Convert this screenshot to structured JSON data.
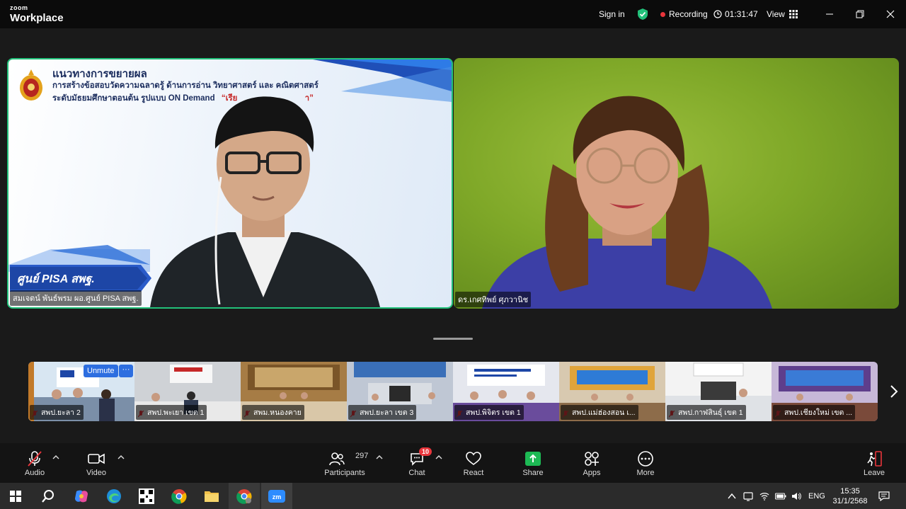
{
  "app": {
    "brand_top": "zoom",
    "brand_bottom": "Workplace",
    "sign_in": "Sign in",
    "recording_label": "Recording",
    "timer": "01:31:47",
    "view_label": "View"
  },
  "slide": {
    "title": "แนวทางการขยายผล",
    "line1": "การสร้างข้อสอบวัดความฉลาดรู้ ด้านการอ่าน วิทยาศาสตร์ และ คณิตศาสตร์",
    "line2": "ระดับมัธยมศึกษาตอนต้น รูปแบบ ON Demand",
    "line2_quote": "“เรีย",
    "line2_end": "า”",
    "banner": "ศูนย์ PISA สพฐ."
  },
  "participants_main": [
    {
      "name": "สมเจตน์ พันธ์พรม ผอ.ศูนย์ PISA สพฐ."
    },
    {
      "name": "ดร.เกศทิพย์ ศุภวานิช"
    }
  ],
  "thumbnails": {
    "unmute_label": "Unmute",
    "more_label": "···",
    "items": [
      {
        "label": "สพป.ยะลา 2"
      },
      {
        "label": "สพป.พะเยา เขต 1"
      },
      {
        "label": "สพม.หนองคาย"
      },
      {
        "label": "สพป.ยะลา เขต 3"
      },
      {
        "label": "สพป.พิจิตร เขต 1"
      },
      {
        "label": "สพป.แม่ฮ่องสอน เ..."
      },
      {
        "label": "สพป.กาฬสินธุ์ เขต 1"
      },
      {
        "label": "สพป.เชียงใหม่ เขต ..."
      }
    ]
  },
  "toolbar": {
    "audio": "Audio",
    "video": "Video",
    "participants": "Participants",
    "participants_count": "297",
    "chat": "Chat",
    "chat_badge": "10",
    "react": "React",
    "share": "Share",
    "apps": "Apps",
    "more": "More",
    "leave": "Leave"
  },
  "taskbar": {
    "lang": "ENG",
    "time": "15:35",
    "date": "31/1/2568"
  },
  "colors": {
    "accent_green": "#22c07a",
    "share_green": "#1db954",
    "leave_red": "#e8353b",
    "recording_red": "#e8353b"
  }
}
